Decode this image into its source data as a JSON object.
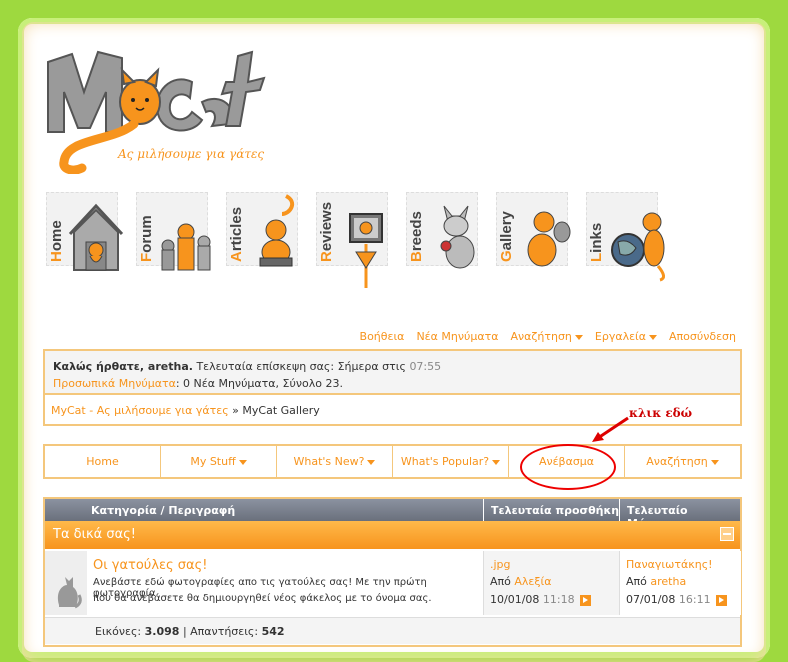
{
  "logo": {
    "wordmark": "MyCat",
    "tagline": "Ας μιλήσουμε για γάτες"
  },
  "nav_tiles": [
    {
      "first": "H",
      "rest": "ome",
      "icon": "house-cat-icon"
    },
    {
      "first": "F",
      "rest": "orum",
      "icon": "cats-group-icon"
    },
    {
      "first": "A",
      "rest": "rticles",
      "icon": "cat-reading-icon"
    },
    {
      "first": "R",
      "rest": "eviews",
      "icon": "cat-tv-icon"
    },
    {
      "first": "B",
      "rest": "reeds",
      "icon": "siamese-cat-icon"
    },
    {
      "first": "G",
      "rest": "allery",
      "icon": "cat-camera-icon"
    },
    {
      "first": "L",
      "rest": "inks",
      "icon": "cat-globe-icon"
    }
  ],
  "toplinks": {
    "help": "Βοήθεια",
    "new_posts": "Νέα Μηνύματα",
    "search": "Αναζήτηση",
    "tools": "Εργαλεία",
    "logout": "Αποσύνδεση"
  },
  "welcome": {
    "greeting": "Καλώς ήρθατε, aretha.",
    "last_visit_label": "Τελευταία επίσκεψη σας: Σήμερα στις",
    "last_visit_time": "07:55",
    "pm_label": "Προσωπικά Μηνύματα",
    "pm_info": ": 0 Νέα Μηνύματα, Σύνολο 23."
  },
  "breadcrumb": {
    "home": "MyCat - Ας μιλήσουμε για γάτες",
    "sep": "»",
    "current": "MyCat Gallery"
  },
  "annotation": {
    "text": "κλικ εδώ"
  },
  "menu": {
    "home": "Home",
    "my_stuff": "My Stuff",
    "whats_new": "What's New?",
    "whats_popular": "What's Popular?",
    "upload": "Ανέβασμα",
    "search": "Αναζήτηση"
  },
  "table": {
    "headers": {
      "category": "Κατηγορία / Περιγραφή",
      "last_added": "Τελευταία προσθήκη",
      "last_post": "Τελευταίο Μήνυμα"
    },
    "section": "Τα δικά σας!",
    "row": {
      "title": "Οι γατούλες σας!",
      "desc_line1": "Ανεβάστε εδώ φωτογραφίες απο τις γατούλες σας! Με την πρώτη φωτογραφία",
      "desc_line2": "που θα ανεβάσετε θα δημιουργηθεί νέος φάκελος με το όνομα σας.",
      "added_file": ".jpg",
      "by_label": "Από",
      "added_by": "Αλεξία",
      "added_date": "10/01/08",
      "added_time": "11:18",
      "post_title": "Παναγιωτάκης!",
      "post_by": "aretha",
      "post_date": "07/01/08",
      "post_time": "16:11"
    },
    "stats": {
      "images_label": "Εικόνες:",
      "images": "3.098",
      "sep": "|",
      "replies_label": "Απαντήσεις:",
      "replies": "542"
    }
  },
  "colors": {
    "accent": "#f7941d",
    "page_bg": "#9ed93f",
    "border": "#f4c77c",
    "header_gray": "#7a808c"
  }
}
